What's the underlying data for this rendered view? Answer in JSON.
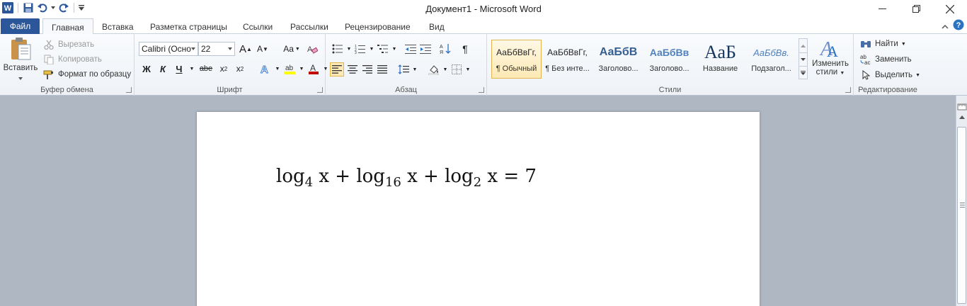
{
  "window": {
    "title": "Документ1  -  Microsoft Word"
  },
  "tabs": {
    "file": "Файл",
    "items": [
      "Главная",
      "Вставка",
      "Разметка страницы",
      "Ссылки",
      "Рассылки",
      "Рецензирование",
      "Вид"
    ],
    "active": "Главная"
  },
  "clipboard": {
    "paste": "Вставить",
    "cut": "Вырезать",
    "copy": "Копировать",
    "format_painter": "Формат по образцу",
    "label": "Буфер обмена"
  },
  "font": {
    "name": "Calibri (Осно",
    "size": "22",
    "label": "Шрифт",
    "bold": "Ж",
    "italic": "К",
    "underline": "Ч",
    "strike": "abe",
    "case": "Aa",
    "grow": "A",
    "shrink": "A"
  },
  "paragraph": {
    "label": "Абзац"
  },
  "styles": {
    "label": "Стили",
    "items": [
      {
        "sample": "АаБбВвГг,",
        "name": "¶ Обычный"
      },
      {
        "sample": "АаБбВвГг,",
        "name": "¶ Без инте..."
      },
      {
        "sample": "АаБбВ",
        "name": "Заголово..."
      },
      {
        "sample": "АаБбВв",
        "name": "Заголово..."
      },
      {
        "sample": "АаБ",
        "name": "Название"
      },
      {
        "sample": "АаБбВв.",
        "name": "Подзагол..."
      }
    ],
    "change_styles": "Изменить",
    "change_styles_2": "стили"
  },
  "editing": {
    "label": "Редактирование",
    "find": "Найти",
    "replace": "Заменить",
    "select": "Выделить"
  },
  "document": {
    "equation": {
      "t1": "log",
      "s1": "4",
      "t2": " x + log",
      "s2": "16",
      "t3": " x + log",
      "s3": "2",
      "t4": " x = 7"
    }
  },
  "colors": {
    "file_tab": "#2b579a",
    "selected_style": "#fde9b5",
    "font_color": "#c00000",
    "highlight": "#ffff00"
  }
}
